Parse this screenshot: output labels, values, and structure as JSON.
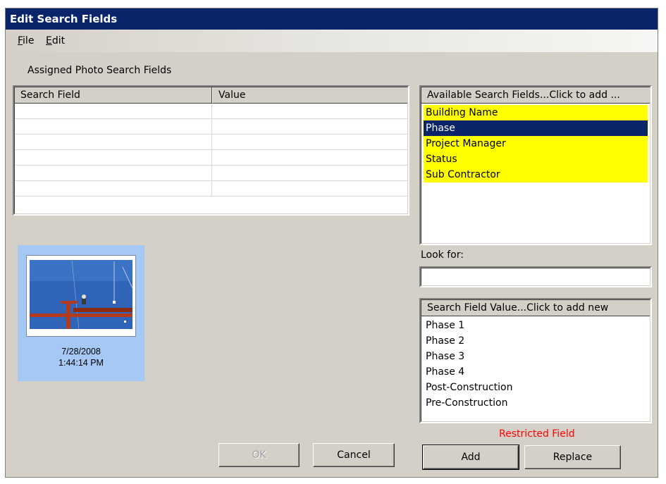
{
  "window": {
    "title": "Edit Search Fields"
  },
  "menu": {
    "file": "File",
    "edit": "Edit"
  },
  "assigned_label": "Assigned Photo Search Fields",
  "grid": {
    "columns": [
      "Search Field",
      "Value"
    ],
    "rows": [
      [
        "",
        ""
      ],
      [
        "",
        ""
      ],
      [
        "",
        ""
      ],
      [
        "",
        ""
      ],
      [
        "",
        ""
      ],
      [
        "",
        ""
      ]
    ]
  },
  "thumbnail": {
    "date": "7/28/2008",
    "time": "1:44:14 PM"
  },
  "available": {
    "header": "Available Search Fields...Click to add ...",
    "items": [
      "Building Name",
      "Phase",
      "Project Manager",
      "Status",
      "Sub Contractor"
    ],
    "selected_index": 1,
    "highlight_color": "#ffff00",
    "selection_color": "#0a246a"
  },
  "look_for": {
    "label": "Look for:",
    "value": ""
  },
  "values": {
    "header": "Search Field Value...Click to add new",
    "items": [
      "Phase 1",
      "Phase 2",
      "Phase 3",
      "Phase 4",
      "Post-Construction",
      "Pre-Construction"
    ]
  },
  "restricted": {
    "text": "Restricted Field",
    "color": "#ff0000"
  },
  "buttons": {
    "ok": "OK",
    "cancel": "Cancel",
    "add": "Add",
    "replace": "Replace"
  }
}
